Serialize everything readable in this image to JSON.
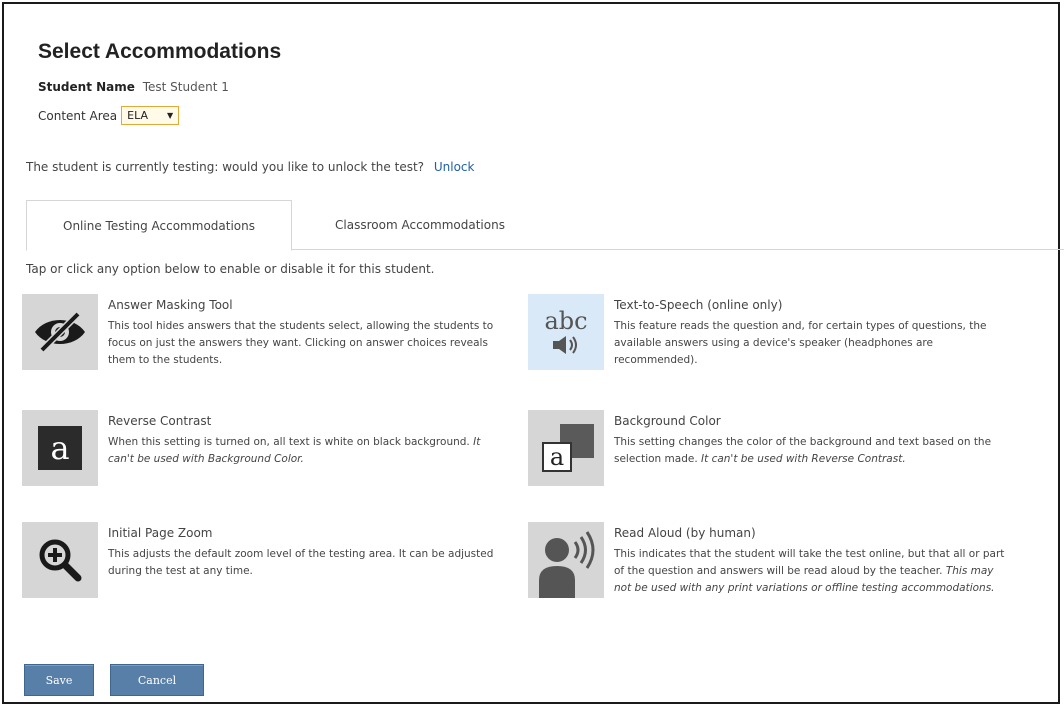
{
  "page": {
    "title": "Select Accommodations",
    "student_label": "Student Name",
    "student_name": "Test Student 1",
    "content_area_label": "Content Area",
    "content_area_value": "ELA"
  },
  "unlock": {
    "prompt": "The student is currently testing: would you like to unlock the test?",
    "link": "Unlock"
  },
  "tabs": [
    {
      "label": "Online Testing Accommodations",
      "active": true
    },
    {
      "label": "Classroom Accommodations",
      "active": false
    }
  ],
  "instruction": "Tap or click any option below to enable or disable it for this student.",
  "accommodations": [
    {
      "name": "Answer Masking Tool",
      "icon": "eye-slash-icon",
      "description": "This tool hides answers that the students select, allowing the students to focus on just the answers they want. Clicking on answer choices reveals them to the students.",
      "note": ""
    },
    {
      "name": "Text-to-Speech (online only)",
      "icon": "text-to-speech-icon",
      "icon_text": "abc",
      "enabled": true,
      "description": "This feature reads the question and, for certain types of questions, the available answers using a device's speaker (headphones are recommended).",
      "note": ""
    },
    {
      "name": "Reverse Contrast",
      "icon": "reverse-contrast-icon",
      "icon_text": "a",
      "description": "When this setting is turned on, all text is white on black background.",
      "note": "It can't be used with Background Color."
    },
    {
      "name": "Background Color",
      "icon": "background-color-icon",
      "icon_text": "a",
      "description": "This setting changes the color of the background and text based on the selection made.",
      "note": "It can't be used with Reverse Contrast."
    },
    {
      "name": "Initial Page Zoom",
      "icon": "zoom-in-icon",
      "description": "This adjusts the default zoom level of the testing area. It can be adjusted during the test at any time.",
      "note": ""
    },
    {
      "name": "Read Aloud (by human)",
      "icon": "read-aloud-icon",
      "description": "This indicates that the student will take the test online, but that all or part of the question and answers will be read aloud by the teacher.",
      "note": "This may not be used with any print variations or offline testing accommodations."
    }
  ],
  "buttons": {
    "save": "Save",
    "cancel": "Cancel"
  },
  "colors": {
    "link": "#1f5fa8",
    "button": "#587fa8",
    "icon_bg": "#d6d6d6",
    "icon_bg_enabled": "#d9e9f7",
    "select_border": "#e0a93a"
  }
}
